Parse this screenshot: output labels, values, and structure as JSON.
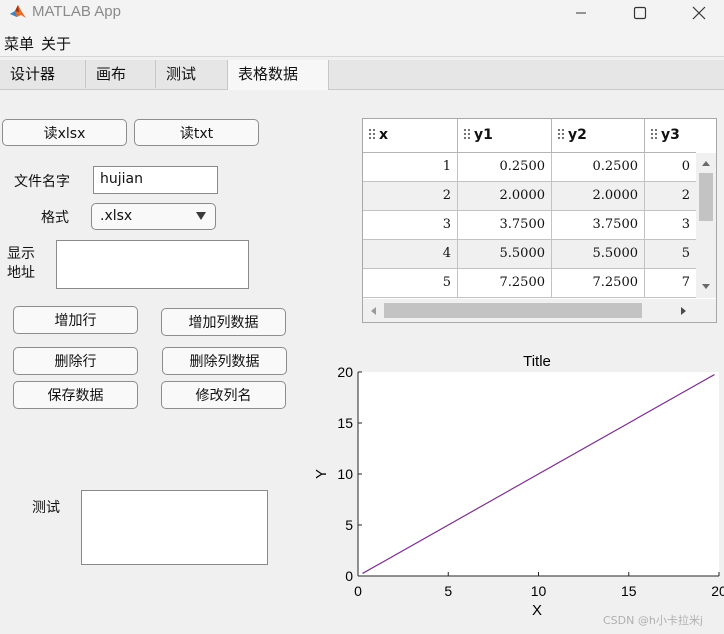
{
  "window": {
    "title": "MATLAB App"
  },
  "menu": [
    "菜单",
    "关于"
  ],
  "tabs": [
    {
      "label": "设计器"
    },
    {
      "label": "画布"
    },
    {
      "label": "测试"
    },
    {
      "label": "表格数据",
      "selected": true
    }
  ],
  "buttons": {
    "read_xlsx": "读xlsx",
    "read_txt": "读txt",
    "add_row": "增加行",
    "add_column": "增加列数据",
    "delete_row": "删除行",
    "delete_column": "删除列数据",
    "save_data": "保存数据",
    "rename_column": "修改列名"
  },
  "form": {
    "filename_label": "文件名字",
    "filename_value": "hujian",
    "format_label": "格式",
    "format_value": ".xlsx",
    "address_label_line1": "显示",
    "address_label_line2": "地址",
    "test_label": "测试"
  },
  "table": {
    "columns": [
      "x",
      "y1",
      "y2",
      "y3"
    ],
    "rows": [
      [
        "1",
        "0.2500",
        "0.2500",
        "0"
      ],
      [
        "2",
        "2.0000",
        "2.0000",
        "2"
      ],
      [
        "3",
        "3.7500",
        "3.7500",
        "3"
      ],
      [
        "4",
        "5.5000",
        "5.5000",
        "5"
      ],
      [
        "5",
        "7.2500",
        "7.2500",
        "7"
      ]
    ]
  },
  "chart_data": {
    "type": "line",
    "title": "Title",
    "xlabel": "X",
    "ylabel": "Y",
    "xlim": [
      0,
      20
    ],
    "ylim": [
      0,
      20
    ],
    "xticks": [
      0,
      5,
      10,
      15,
      20
    ],
    "yticks": [
      0,
      5,
      10,
      15,
      20
    ],
    "grid": false,
    "series": [
      {
        "x": [
          0.25,
          19.75
        ],
        "y": [
          0.25,
          19.75
        ],
        "color": "#7e2f8e"
      }
    ]
  },
  "watermark": "CSDN @h小卡拉米j"
}
